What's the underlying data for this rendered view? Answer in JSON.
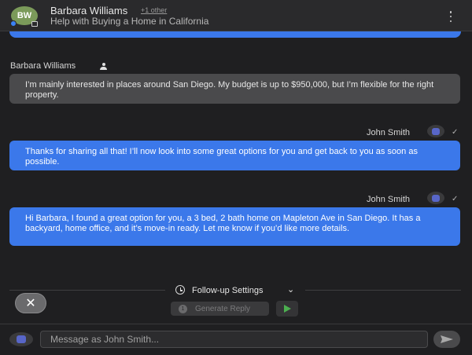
{
  "header": {
    "avatar_initials": "BW",
    "contact_name": "Barbara Williams",
    "others_link": "+1 other",
    "subject": "Help with Buying a Home in California"
  },
  "messages": [
    {
      "sender": "Barbara Williams",
      "direction": "incoming",
      "text": "I’m mainly interested in places around San Diego. My budget is up to $950,000, but I’m flexible for the right property."
    },
    {
      "sender": "John Smith",
      "direction": "outgoing",
      "status_glyph": "✓",
      "text": "Thanks for sharing all that! I’ll now look into some great options for you and get back to you as soon as possible."
    },
    {
      "sender": "John Smith",
      "direction": "outgoing",
      "status_glyph": "✓",
      "text": "Hi Barbara, I found a great option for you, a 3 bed, 2 bath home on Mapleton Ave in San Diego. It has a backyard, home office, and it’s move-in ready. Let me know if you’d like more details."
    }
  ],
  "followup": {
    "label": "Follow-up Settings",
    "chevron": "⌄"
  },
  "close_glyph": "✕",
  "generate": {
    "count": "1",
    "label": "Generate Reply"
  },
  "composer": {
    "placeholder": "Message as John Smith..."
  },
  "colors": {
    "outgoing_bubble": "#3b78ea",
    "incoming_bubble": "#4a4a4c",
    "background": "#1f1f21",
    "avatar_bw": "#7b9a5a",
    "play_green": "#4caf50"
  },
  "icons": [
    "kebab-menu-icon",
    "user-icon",
    "checkmark-icon",
    "clock-icon",
    "chevron-down-icon",
    "close-icon",
    "play-icon",
    "send-icon"
  ]
}
